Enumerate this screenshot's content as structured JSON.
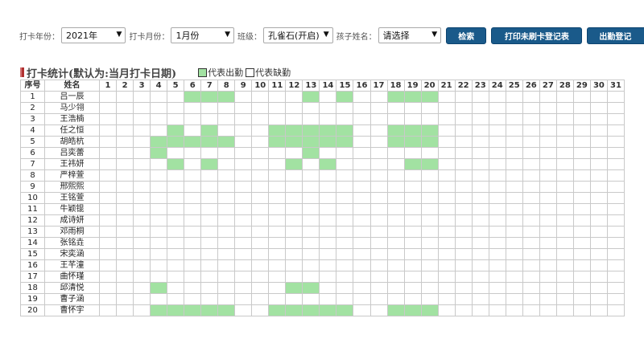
{
  "filters": {
    "year_label": "打卡年份：",
    "year_value": "2021年",
    "month_label": "打卡月份：",
    "month_value": "1月份",
    "class_label": "班级：",
    "class_value": "孔雀石(开启)",
    "child_label": "孩子姓名：",
    "child_value": "请选择",
    "search_button": "检索",
    "print_button": "打印未刷卡登记表",
    "attendance_button": "出勤登记"
  },
  "section": {
    "title": "打卡统计(默认为:当月打卡日期)",
    "legend_present": "代表出勤",
    "legend_absent": "代表缺勤"
  },
  "colors": {
    "present": "#a2e2a2",
    "button": "#1a5a8a",
    "title_bar": "#b03030"
  },
  "table": {
    "header_no": "序号",
    "header_name": "姓名",
    "days": [
      "1",
      "2",
      "3",
      "4",
      "5",
      "6",
      "7",
      "8",
      "9",
      "10",
      "11",
      "12",
      "13",
      "14",
      "15",
      "16",
      "17",
      "18",
      "19",
      "20",
      "21",
      "22",
      "23",
      "24",
      "25",
      "26",
      "27",
      "28",
      "29",
      "30",
      "31"
    ],
    "rows": [
      {
        "no": "1",
        "name": "吕一辰",
        "present": [
          6,
          7,
          8,
          13,
          15,
          18,
          19,
          20
        ]
      },
      {
        "no": "2",
        "name": "马少翎",
        "present": []
      },
      {
        "no": "3",
        "name": "王浩楠",
        "present": []
      },
      {
        "no": "4",
        "name": "任之恒",
        "present": [
          5,
          7,
          11,
          12,
          13,
          14,
          15,
          18,
          19,
          20
        ]
      },
      {
        "no": "5",
        "name": "胡皓杭",
        "present": [
          4,
          5,
          6,
          7,
          8,
          11,
          12,
          13,
          14,
          15,
          18,
          19,
          20
        ]
      },
      {
        "no": "6",
        "name": "吕奕蕾",
        "present": [
          4,
          13
        ]
      },
      {
        "no": "7",
        "name": "王祎妍",
        "present": [
          5,
          7,
          12,
          14,
          19,
          20
        ]
      },
      {
        "no": "8",
        "name": "严梓萱",
        "present": []
      },
      {
        "no": "9",
        "name": "邢熙熙",
        "present": []
      },
      {
        "no": "10",
        "name": "王铭萱",
        "present": []
      },
      {
        "no": "11",
        "name": "牛颖锟",
        "present": []
      },
      {
        "no": "12",
        "name": "成诗妍",
        "present": []
      },
      {
        "no": "13",
        "name": "邓雨桐",
        "present": []
      },
      {
        "no": "14",
        "name": "张铭垚",
        "present": []
      },
      {
        "no": "15",
        "name": "宋奕涵",
        "present": []
      },
      {
        "no": "16",
        "name": "王芊潼",
        "present": []
      },
      {
        "no": "17",
        "name": "曲怀瑾",
        "present": []
      },
      {
        "no": "18",
        "name": "邱清悦",
        "present": [
          4,
          12,
          13
        ]
      },
      {
        "no": "19",
        "name": "曹子涵",
        "present": []
      },
      {
        "no": "20",
        "name": "曹怀宇",
        "present": [
          4,
          5,
          6,
          7,
          8,
          11,
          12,
          13,
          14,
          15,
          18,
          19,
          20
        ]
      }
    ]
  }
}
